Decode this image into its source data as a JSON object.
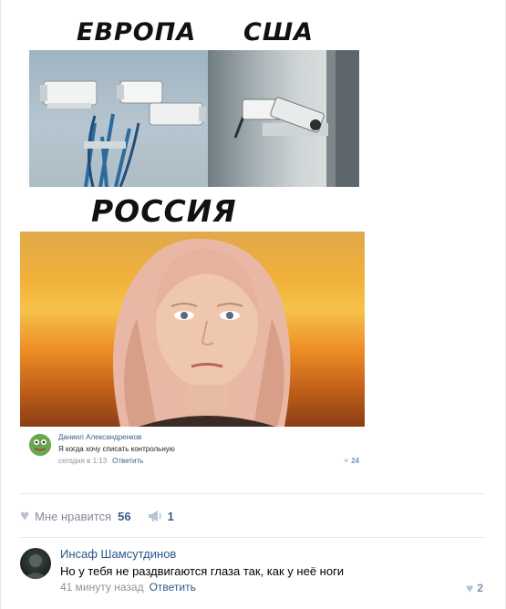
{
  "meme": {
    "label_left": "ЕВРОПА",
    "label_right": "США",
    "label_bottom": "РОССИЯ"
  },
  "embedded_comment": {
    "author": "Даниил Александренков",
    "text": "Я когда хочу списать контрольную",
    "time": "сегодня в 1:13",
    "reply_label": "Ответить",
    "likes": "24"
  },
  "post_actions": {
    "like_label": "Мне нравится",
    "like_count": "56",
    "share_count": "1"
  },
  "comment": {
    "author": "Инсаф Шамсутдинов",
    "text": "Но у тебя не раздвигаются глаза так, как у неё ноги",
    "time": "41 минуту назад",
    "reply_label": "Ответить",
    "likes": "2"
  },
  "icons": {
    "heart": "heart-icon",
    "share": "megaphone-share-icon"
  },
  "colors": {
    "link": "#2a5885",
    "meta": "#939393",
    "icon": "#b7c3d3"
  }
}
